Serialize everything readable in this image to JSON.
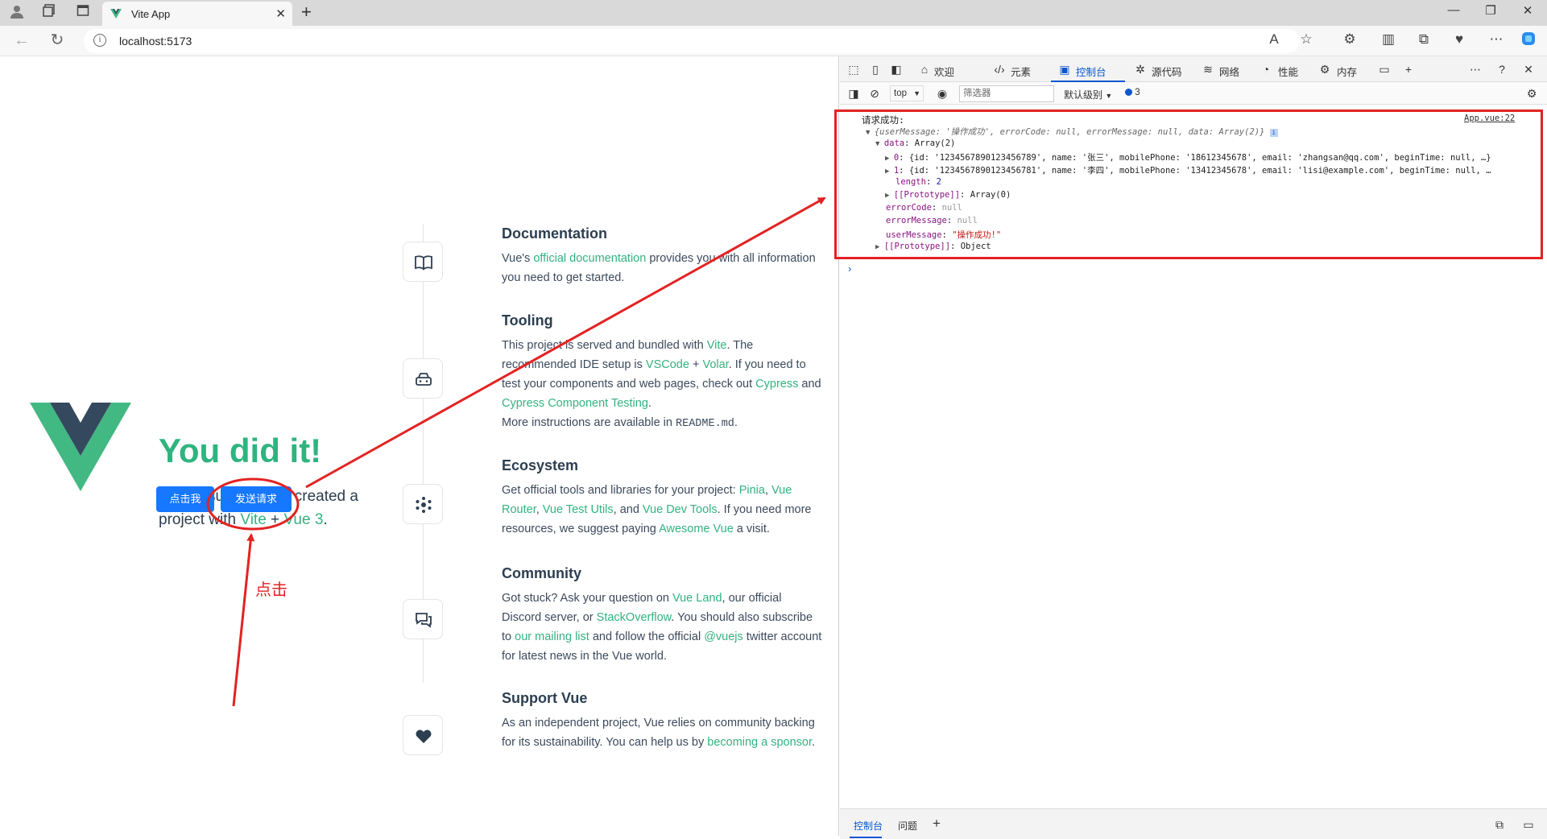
{
  "browser": {
    "tab_title": "Vite App",
    "url": "localhost:5173"
  },
  "hero": {
    "title": "You did it!",
    "sub_1": "You've successfully created a project with ",
    "vite": "Vite",
    "plus": " + ",
    "vue3": "Vue 3",
    "dot": ".",
    "btn_click": "点击我",
    "btn_send": "发送请求"
  },
  "features": {
    "doc": {
      "title": "Documentation",
      "t1": "Vue's ",
      "l1": "official documentation",
      "t2": " provides you with all information you need to get started."
    },
    "tooling": {
      "title": "Tooling",
      "t1": "This project is served and bundled with ",
      "l1": "Vite",
      "t2": ". The recommended IDE setup is ",
      "l2": "VSCode",
      "t3": " + ",
      "l3": "Volar",
      "t4": ". If you need to test your components and web pages, check out ",
      "l4": "Cypress",
      "t5": " and ",
      "l5": "Cypress Component Testing",
      "t6": ".",
      "t7": "More instructions are available in ",
      "code": "README.md",
      "t8": "."
    },
    "ecosystem": {
      "title": "Ecosystem",
      "t1": "Get official tools and libraries for your project: ",
      "l1": "Pinia",
      "t2": ", ",
      "l2": "Vue Router",
      "t3": ", ",
      "l3": "Vue Test Utils",
      "t4": ", and ",
      "l4": "Vue Dev Tools",
      "t5": ". If you need more resources, we suggest paying ",
      "l5": "Awesome Vue",
      "t6": " a visit."
    },
    "community": {
      "title": "Community",
      "t1": "Got stuck? Ask your question on ",
      "l1": "Vue Land",
      "t2": ", our official Discord server, or ",
      "l2": "StackOverflow",
      "t3": ". You should also subscribe to ",
      "l3": "our mailing list",
      "t4": " and follow the official ",
      "l4": "@vuejs",
      "t5": " twitter account for latest news in the Vue world."
    },
    "support": {
      "title": "Support Vue",
      "t1": "As an independent project, Vue relies on community backing for its sustainability. You can help us by ",
      "l1": "becoming a sponsor",
      "t2": "."
    }
  },
  "devtools": {
    "tabs": [
      "欢迎",
      "元素",
      "控制台",
      "源代码",
      "网络",
      "性能",
      "内存"
    ],
    "context": "top",
    "filter_placeholder": "筛选器",
    "level": "默认级别",
    "issues_count": "3",
    "bottom_tabs": [
      "控制台",
      "问题"
    ],
    "console": {
      "label": "请求成功:",
      "source": "App.vue:22",
      "summary_1": "{userMessage: ",
      "summary_msg": "'操作成功'",
      "summary_2": ", errorCode: ",
      "summary_null1": "null",
      "summary_3": ", errorMessage: ",
      "summary_null2": "null",
      "summary_4": ", data: Array(2)}",
      "data_key": "data",
      "data_val": "Array(2)",
      "row0_idx": "0",
      "row0": "{id: '1234567890123456789', name: '张三', mobilePhone: '18612345678', email: 'zhangsan@qq.com', beginTime: null, …}",
      "row1_idx": "1",
      "row1": "{id: '1234567890123456781', name: '李四', mobilePhone: '13412345678', email: 'lisi@example.com', beginTime: null, …",
      "length_key": "length",
      "length_val": "2",
      "proto_key": "[[Prototype]]",
      "proto_arr": "Array(0)",
      "ec_key": "errorCode",
      "ec_val": "null",
      "em_key": "errorMessage",
      "em_val": "null",
      "um_key": "userMessage",
      "um_val": "\"操作成功!\"",
      "proto_obj": "Object"
    }
  },
  "annotation": {
    "click_label": "点击",
    "color": "#e32222"
  },
  "colors": {
    "vue_green": "#42b883",
    "vue_dark": "#35495e",
    "button_blue": "#1677ff",
    "link_green": "#33b280"
  }
}
